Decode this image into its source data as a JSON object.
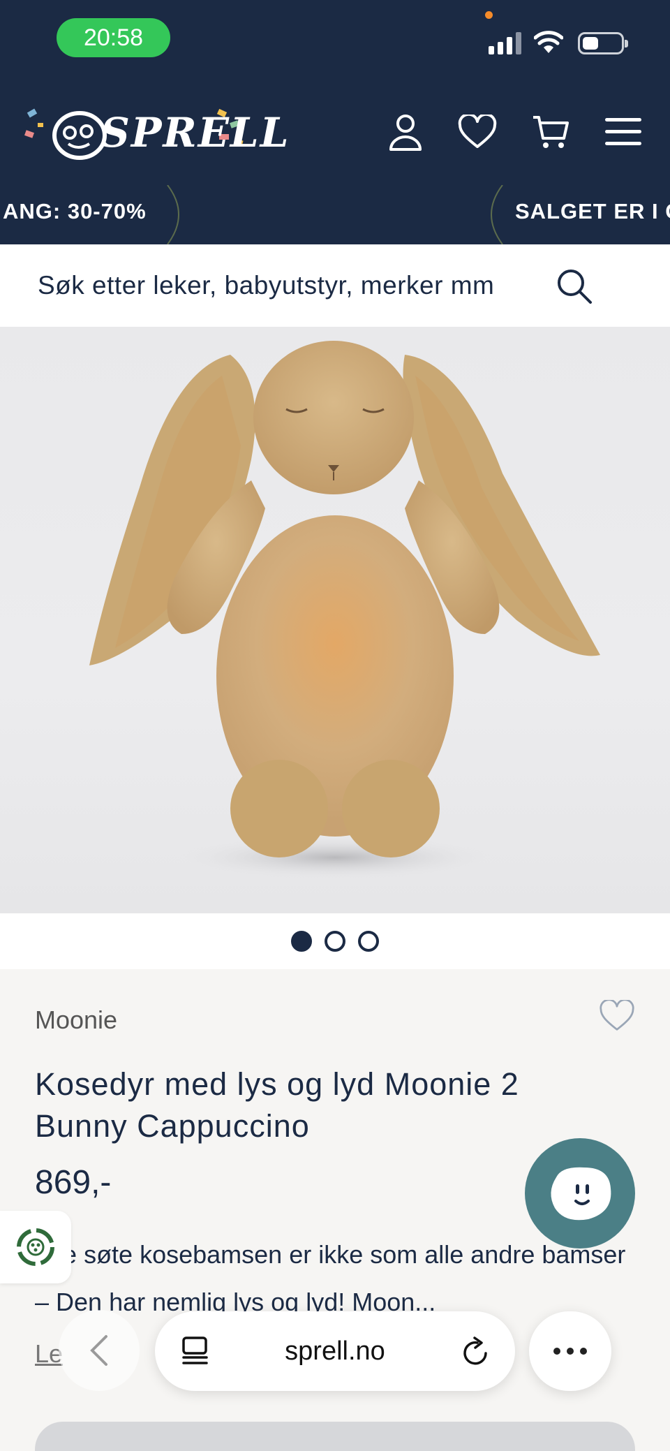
{
  "status_bar": {
    "time": "20:58"
  },
  "header": {
    "logo_text": "SPRELL",
    "icons": [
      "account-icon",
      "heart-icon",
      "cart-icon",
      "menu-icon"
    ]
  },
  "marquee": {
    "left_text": "ANG: 30-70%",
    "right_text": "SALGET ER I G"
  },
  "search": {
    "placeholder": "Søk etter leker, babyutstyr, merker mm"
  },
  "product": {
    "brand": "Moonie",
    "title": "Kosedyr med lys og lyd Moonie 2 Bunny Cappuccino",
    "price": "869,-",
    "description": "nne søte kosebamsen er ikke som alle andre bamser – Den har nemlig lys og lyd! Moon...",
    "read_more": "Le",
    "image_slides_total": 3,
    "image_slide_active": 1
  },
  "browser": {
    "url": "sprell.no"
  },
  "colors": {
    "header_bg": "#1b2a44",
    "accent_chat": "#4b7f86",
    "status_green": "#34c759",
    "info_bg": "#f6f5f3"
  }
}
